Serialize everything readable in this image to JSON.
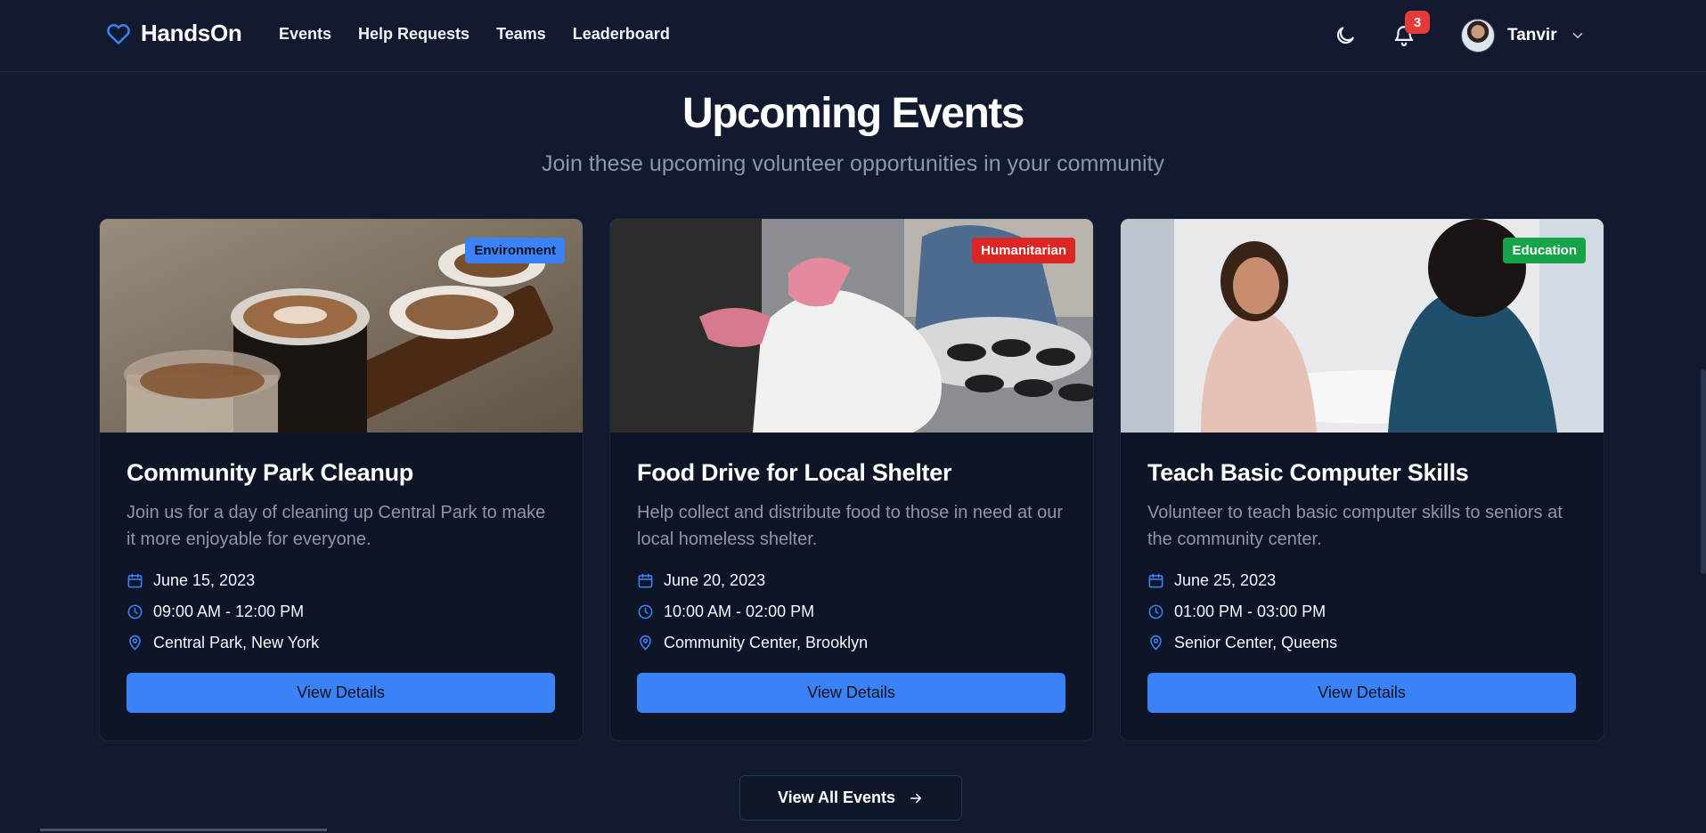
{
  "brand": {
    "name": "HandsOn",
    "accent": "#3b82f6"
  },
  "nav": [
    "Events",
    "Help Requests",
    "Teams",
    "Leaderboard"
  ],
  "header": {
    "notifications_count": "3",
    "user_name": "Tanvir",
    "theme_icon": "moon-icon",
    "bell_icon": "bell-icon"
  },
  "section": {
    "title": "Upcoming Events",
    "subtitle": "Join these upcoming volunteer opportunities in your community"
  },
  "events": [
    {
      "category": "Environment",
      "category_bg": "#3b82f6",
      "category_fg": "#0b1220",
      "title": "Community Park Cleanup",
      "description": "Join us for a day of cleaning up Central Park to make it more enjoyable for everyone.",
      "date": "June 15, 2023",
      "time": "09:00 AM - 12:00 PM",
      "location": "Central Park, New York",
      "button": "View Details"
    },
    {
      "category": "Humanitarian",
      "category_bg": "#dc2626",
      "category_fg": "#ffffff",
      "title": "Food Drive for Local Shelter",
      "description": "Help collect and distribute food to those in need at our local homeless shelter.",
      "date": "June 20, 2023",
      "time": "10:00 AM - 02:00 PM",
      "location": "Community Center, Brooklyn",
      "button": "View Details"
    },
    {
      "category": "Education",
      "category_bg": "#16a34a",
      "category_fg": "#ffffff",
      "title": "Teach Basic Computer Skills",
      "description": "Volunteer to teach basic computer skills to seniors at the community center.",
      "date": "June 25, 2023",
      "time": "01:00 PM - 03:00 PM",
      "location": "Senior Center, Queens",
      "button": "View Details"
    }
  ],
  "view_all": "View All Events"
}
